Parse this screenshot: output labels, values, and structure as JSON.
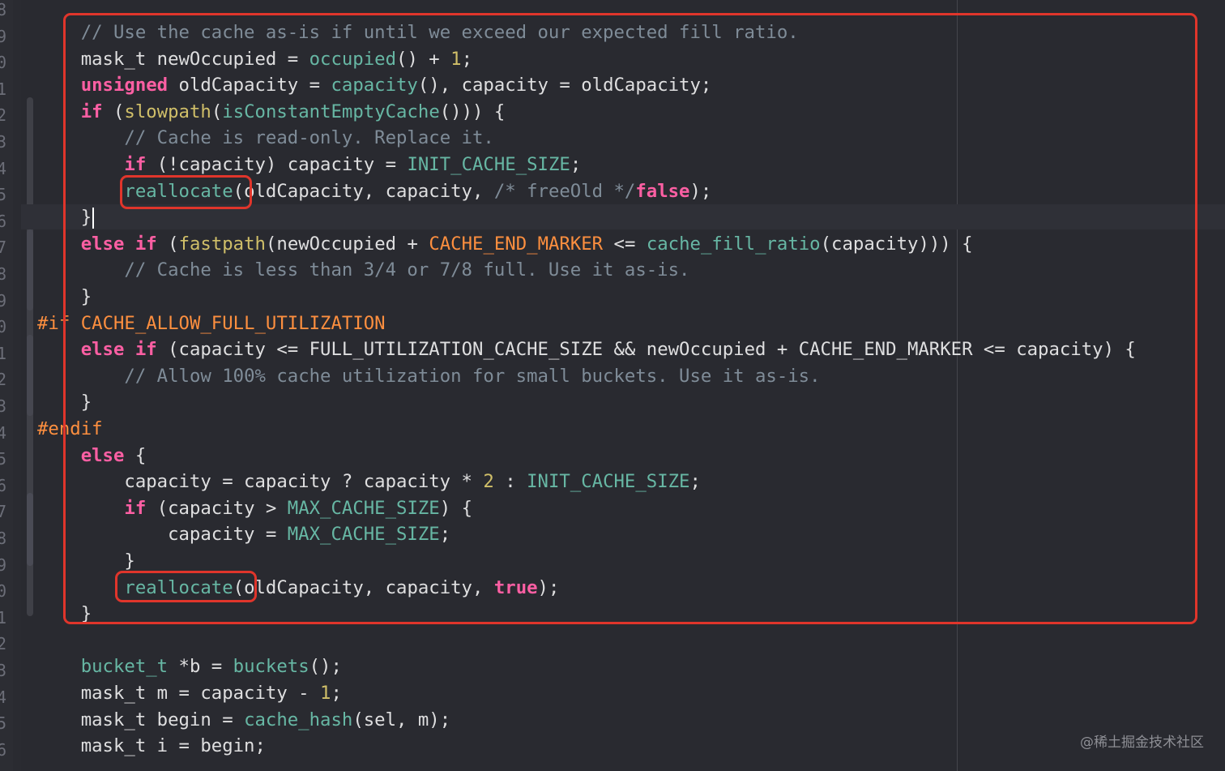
{
  "editor": {
    "gutter_numbers": [
      "8",
      "9",
      "0",
      "1",
      "2",
      "3",
      "4",
      "5",
      "6",
      "7",
      "8",
      "9",
      "0",
      "1",
      "2",
      "3",
      "4",
      "5",
      "6",
      "7",
      "8",
      "9",
      "0",
      "1",
      "2",
      "3",
      "4",
      "5",
      "6"
    ],
    "lines": [
      [
        {
          "t": "    "
        },
        {
          "t": "// Use the cache as-is if until we exceed our expected fill ratio.",
          "c": "cm"
        }
      ],
      [
        {
          "t": "    mask_t newOccupied = "
        },
        {
          "t": "occupied",
          "c": "fn"
        },
        {
          "t": "() + "
        },
        {
          "t": "1",
          "c": "nm"
        },
        {
          "t": ";"
        }
      ],
      [
        {
          "t": "    "
        },
        {
          "t": "unsigned",
          "c": "kw"
        },
        {
          "t": " oldCapacity = "
        },
        {
          "t": "capacity",
          "c": "fn"
        },
        {
          "t": "(), capacity = oldCapacity;"
        }
      ],
      [
        {
          "t": "    "
        },
        {
          "t": "if",
          "c": "kw"
        },
        {
          "t": " ("
        },
        {
          "t": "slowpath",
          "c": "ty"
        },
        {
          "t": "("
        },
        {
          "t": "isConstantEmptyCache",
          "c": "fn"
        },
        {
          "t": "())) {"
        }
      ],
      [
        {
          "t": "        "
        },
        {
          "t": "// Cache is read-only. Replace it.",
          "c": "cm"
        }
      ],
      [
        {
          "t": "        "
        },
        {
          "t": "if",
          "c": "kw"
        },
        {
          "t": " (!capacity) capacity = "
        },
        {
          "t": "INIT_CACHE_SIZE",
          "c": "fn"
        },
        {
          "t": ";"
        }
      ],
      [
        {
          "t": "        "
        },
        {
          "t": "reallocate",
          "c": "fn"
        },
        {
          "t": "(oldCapacity, capacity, "
        },
        {
          "t": "/* freeOld */",
          "c": "cm"
        },
        {
          "t": "false",
          "c": "kw"
        },
        {
          "t": ");"
        }
      ],
      [
        {
          "t": "    }"
        },
        {
          "caret": true
        }
      ],
      [
        {
          "t": "    "
        },
        {
          "t": "else",
          "c": "kw"
        },
        {
          "t": " "
        },
        {
          "t": "if",
          "c": "kw"
        },
        {
          "t": " ("
        },
        {
          "t": "fastpath",
          "c": "ty"
        },
        {
          "t": "(newOccupied + "
        },
        {
          "t": "CACHE_END_MARKER",
          "c": "pp"
        },
        {
          "t": " <= "
        },
        {
          "t": "cache_fill_ratio",
          "c": "fn"
        },
        {
          "t": "(capacity))) {"
        }
      ],
      [
        {
          "t": "        "
        },
        {
          "t": "// Cache is less than 3/4 or 7/8 full. Use it as-is.",
          "c": "cm"
        }
      ],
      [
        {
          "t": "    }"
        }
      ],
      [
        {
          "t": "#if",
          "c": "pp"
        },
        {
          "t": " "
        },
        {
          "t": "CACHE_ALLOW_FULL_UTILIZATION",
          "c": "pp"
        }
      ],
      [
        {
          "t": "    "
        },
        {
          "t": "else",
          "c": "kw"
        },
        {
          "t": " "
        },
        {
          "t": "if",
          "c": "kw"
        },
        {
          "t": " (capacity <= FULL_UTILIZATION_CACHE_SIZE && newOccupied + CACHE_END_MARKER <= capacity) {"
        }
      ],
      [
        {
          "t": "        "
        },
        {
          "t": "// Allow 100% cache utilization for small buckets. Use it as-is.",
          "c": "cm"
        }
      ],
      [
        {
          "t": "    }"
        }
      ],
      [
        {
          "t": "#endif",
          "c": "pp"
        }
      ],
      [
        {
          "t": "    "
        },
        {
          "t": "else",
          "c": "kw"
        },
        {
          "t": " {"
        }
      ],
      [
        {
          "t": "        capacity = capacity ? capacity * "
        },
        {
          "t": "2",
          "c": "nm"
        },
        {
          "t": " : "
        },
        {
          "t": "INIT_CACHE_SIZE",
          "c": "fn"
        },
        {
          "t": ";"
        }
      ],
      [
        {
          "t": "        "
        },
        {
          "t": "if",
          "c": "kw"
        },
        {
          "t": " (capacity > "
        },
        {
          "t": "MAX_CACHE_SIZE",
          "c": "fn"
        },
        {
          "t": ") {"
        }
      ],
      [
        {
          "t": "            capacity = "
        },
        {
          "t": "MAX_CACHE_SIZE",
          "c": "fn"
        },
        {
          "t": ";"
        }
      ],
      [
        {
          "t": "        }"
        }
      ],
      [
        {
          "t": "        "
        },
        {
          "t": "reallocate",
          "c": "fn"
        },
        {
          "t": "(oldCapacity, capacity, "
        },
        {
          "t": "true",
          "c": "kw"
        },
        {
          "t": ");"
        }
      ],
      [
        {
          "t": "    }"
        }
      ],
      [
        {
          "t": ""
        }
      ],
      [
        {
          "t": "    "
        },
        {
          "t": "bucket_t",
          "c": "fn"
        },
        {
          "t": " *b = "
        },
        {
          "t": "buckets",
          "c": "fn"
        },
        {
          "t": "();"
        }
      ],
      [
        {
          "t": "    mask_t m = capacity - "
        },
        {
          "t": "1",
          "c": "nm"
        },
        {
          "t": ";"
        }
      ],
      [
        {
          "t": "    mask_t begin = "
        },
        {
          "t": "cache_hash",
          "c": "fn"
        },
        {
          "t": "(sel, m);"
        }
      ],
      [
        {
          "t": "    mask_t i = begin;"
        }
      ]
    ]
  },
  "watermark": "@稀土掘金技术社区"
}
